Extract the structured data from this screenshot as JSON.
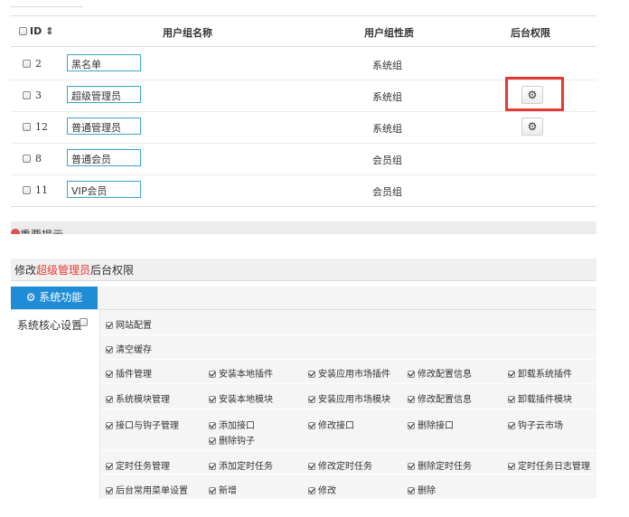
{
  "table": {
    "headers": {
      "id": "ID",
      "sort_icon": "sort-icon",
      "name": "用户组名称",
      "nature": "用户组性质",
      "perm": "后台权限"
    },
    "rows": [
      {
        "id": "2",
        "name": "黑名单",
        "nature": "系统组",
        "has_perm_button": false
      },
      {
        "id": "3",
        "name": "超级管理员",
        "nature": "系统组",
        "has_perm_button": true
      },
      {
        "id": "12",
        "name": "普通管理员",
        "nature": "系统组",
        "has_perm_button": true
      },
      {
        "id": "8",
        "name": "普通会员",
        "nature": "会员组",
        "has_perm_button": false
      },
      {
        "id": "11",
        "name": "VIP会员",
        "nature": "会员组",
        "has_perm_button": false
      }
    ]
  },
  "band": {
    "text": "重要提示"
  },
  "permissions": {
    "title_prefix": "修改",
    "title_group": "超级管理员",
    "title_suffix": "后台权限",
    "tab_label": "系统功能",
    "section_label": "系统核心设置",
    "rows": [
      [
        "网站配置"
      ],
      [
        "清空缓存"
      ],
      [
        "插件管理",
        "安装本地插件",
        "安装应用市场插件",
        "修改配置信息",
        "卸载系统插件"
      ],
      [
        "系统模块管理",
        "安装本地模块",
        "安装应用市场模块",
        "修改配置信息",
        "卸载插件模块"
      ],
      [
        "接口与钩子管理",
        "添加接口",
        "修改接口",
        "删除接口",
        "钩子云市场",
        "删除钩子"
      ],
      [
        "定时任务管理",
        "添加定时任务",
        "修改定时任务",
        "删除定时任务",
        "定时任务日志管理"
      ],
      [
        "后台常用菜单设置",
        "新增",
        "修改",
        "删除"
      ]
    ]
  },
  "colors": {
    "accent": "#1f8dd6",
    "highlight": "#e8382f",
    "input_border": "#3aa6c8"
  }
}
